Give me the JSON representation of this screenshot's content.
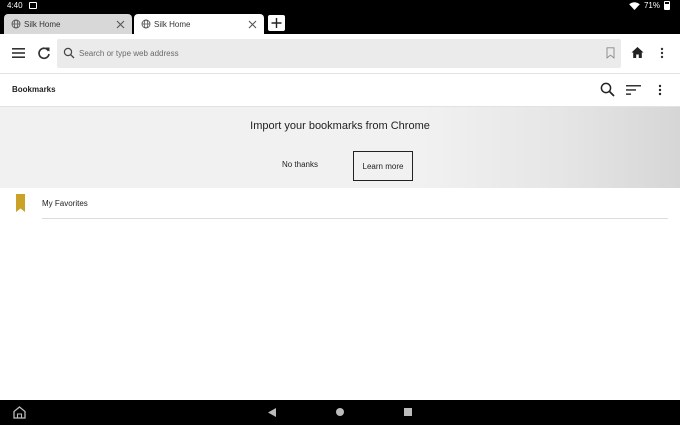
{
  "status_bar": {
    "time": "4:40",
    "battery": "71%"
  },
  "tabs": [
    {
      "title": "Silk Home",
      "active": false
    },
    {
      "title": "Silk Home",
      "active": true
    }
  ],
  "toolbar": {
    "address_placeholder": "Search or type web address"
  },
  "bookmarks_header": {
    "title": "Bookmarks"
  },
  "import_banner": {
    "text": "Import your bookmarks from Chrome",
    "no_thanks_label": "No thanks",
    "learn_more_label": "Learn more"
  },
  "bookmarks": [
    {
      "label": "My Favorites",
      "icon": "bookmark-folder-icon",
      "color": "#c9a227"
    }
  ],
  "colors": {
    "status_bar": "#000000",
    "banner_bg": "#f1f1f1",
    "folder": "#c9a227"
  }
}
